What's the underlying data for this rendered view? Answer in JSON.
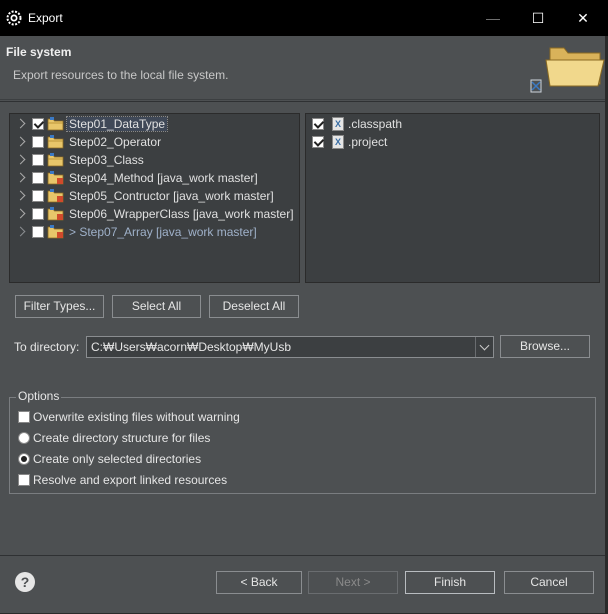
{
  "window": {
    "title": "Export",
    "minimize_glyph": "—",
    "maximize_glyph": "☐",
    "close_glyph": "✕"
  },
  "header": {
    "title": "File system",
    "description": "Export resources to the local file system."
  },
  "left_tree": {
    "items": [
      {
        "label": "Step01_DataType",
        "checked": true,
        "selected": true
      },
      {
        "label": "Step02_Operator",
        "checked": false
      },
      {
        "label": "Step03_Class",
        "checked": false
      },
      {
        "label": "Step04_Method [java_work master]",
        "checked": false
      },
      {
        "label": "Step05_Contructor [java_work master]",
        "checked": false
      },
      {
        "label": "Step06_WrapperClass [java_work master]",
        "checked": false
      },
      {
        "label": "> Step07_Array [java_work master]",
        "checked": false
      }
    ]
  },
  "right_tree": {
    "items": [
      {
        "label": ".classpath",
        "checked": true,
        "icon": "X"
      },
      {
        "label": ".project",
        "checked": true,
        "icon": "X"
      }
    ]
  },
  "buttons": {
    "filter_types": "Filter Types...",
    "select_all": "Select All",
    "deselect_all": "Deselect All",
    "browse": "Browse...",
    "back": "< Back",
    "next": "Next >",
    "finish": "Finish",
    "cancel": "Cancel"
  },
  "directory": {
    "label": "To directory:",
    "value": "C:₩Users₩acorn₩Desktop₩MyUsb"
  },
  "options": {
    "title": "Options",
    "overwrite": "Overwrite existing files without warning",
    "create_structure": "Create directory structure for files",
    "create_selected": "Create only selected directories",
    "resolve_linked": "Resolve and export linked resources"
  },
  "help_glyph": "?",
  "colors": {
    "background": "#4d5052",
    "panel": "#3c3f41",
    "titlebar": "#000000",
    "dim_item": "#9fb1c9"
  }
}
